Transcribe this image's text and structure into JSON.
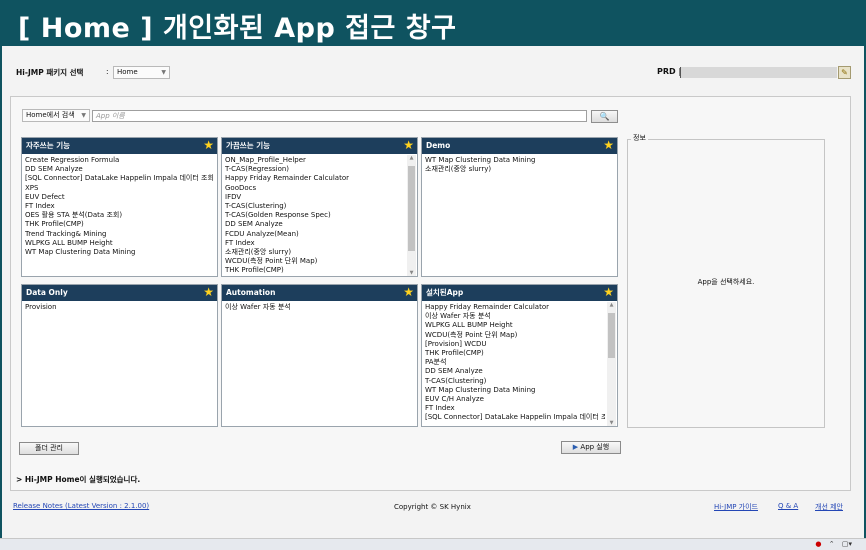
{
  "banner": {
    "title": "[ Home ] 개인화된 App 접근 창구"
  },
  "topbar": {
    "package_label": "Hi-JMP 패키지 선택",
    "colon": ":",
    "package_value": "Home",
    "prd_label": "PRD |"
  },
  "search": {
    "scope_value": "Home에서 검색",
    "placeholder": "App 이름",
    "button_icon": "magnifier-icon"
  },
  "panels": {
    "favorites": {
      "title": "자주쓰는 기능",
      "items": [
        "Create Regression Formula",
        "DD SEM Analyze",
        "[SQL Connector] DataLake Happelin Impala 데이터 조회",
        "XPS",
        "EUV Defect",
        "FT Index",
        "OES 활용 STA 분석(Data 조회)",
        "THK Profile(CMP)",
        "Trend Tracking& Mining",
        "WLPKG ALL BUMP Height",
        "WT Map Clustering Data Mining"
      ]
    },
    "occasional": {
      "title": "가끔쓰는 기능",
      "items": [
        "ON_Map_Profile_Helper",
        "T-CAS(Regression)",
        "Happy Friday Remainder Calculator",
        "GooDocs",
        "IFDV",
        "T-CAS(Clustering)",
        "T-CAS(Golden Response Spec)",
        "DD SEM Analyze",
        "FCDU Analyze(Mean)",
        "FT Index",
        "소재관리(중앙 slurry)",
        "WCDU(측정 Point 단위 Map)",
        "THK Profile(CMP)"
      ]
    },
    "demo": {
      "title": "Demo",
      "items": [
        "WT Map Clustering Data Mining",
        "소재관리(중앙 slurry)"
      ]
    },
    "data_only": {
      "title": "Data Only",
      "items": [
        "Provision"
      ]
    },
    "automation": {
      "title": "Automation",
      "items": [
        "이상 Wafer 자동 분석"
      ]
    },
    "installed": {
      "title": "설치된App",
      "items": [
        "Happy Friday Remainder Calculator",
        "이상 Wafer 자동 분석",
        "WLPKG ALL BUMP Height",
        "WCDU(측정 Point 단위 Map)",
        "[Provision] WCDU",
        "THK Profile(CMP)",
        "PA분석",
        "DD SEM Analyze",
        "T-CAS(Clustering)",
        "WT Map Clustering Data Mining",
        "EUV C/H Analyze",
        "FT Index",
        "[SQL Connector] DataLake Happelin Impala 데이터 조회"
      ]
    }
  },
  "info": {
    "title": "정보",
    "message": "App을 선택하세요."
  },
  "buttons": {
    "folder_manage": "폴더 관리",
    "run_app": "App 실행"
  },
  "status": "> Hi-JMP Home이 실행되었습니다.",
  "footer": {
    "release_notes": "Release Notes (Latest Version : 2.1.00)",
    "copyright": "Copyright © SK Hynix",
    "guide": "Hi-JMP 가이드",
    "qa": "Q & A",
    "suggest": "개선 제안"
  },
  "colors": {
    "banner": "#0f5360",
    "panel_header": "#1d3e5c",
    "star": "#ffd21f",
    "link": "#2346b5"
  }
}
